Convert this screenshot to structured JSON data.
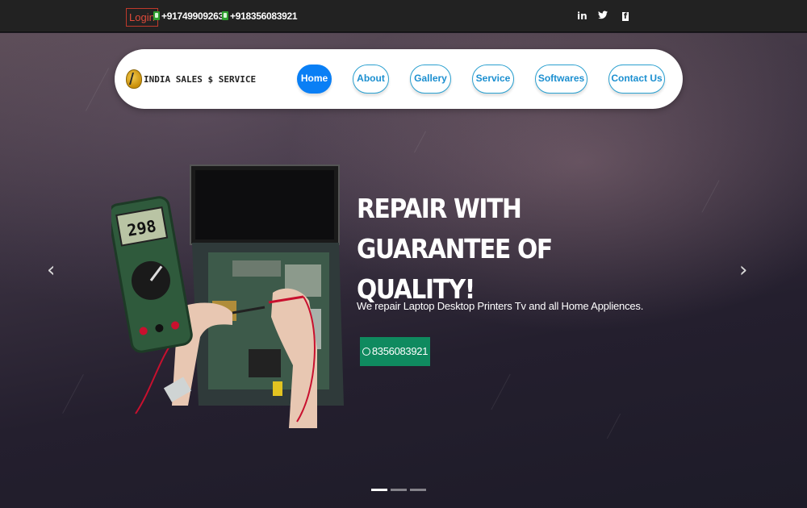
{
  "topbar": {
    "login_label": "Login",
    "phone1": "+917499092630",
    "phone2": "+918356083921",
    "social": [
      "linkedin-icon",
      "twitter-icon",
      "facebook-icon"
    ],
    "social_glyphs": [
      "in",
      "🐦",
      "f"
    ]
  },
  "brand": {
    "name": "INDIA SALES $ SERVICE",
    "logo_icon": "shield-logo-icon"
  },
  "nav": {
    "items": [
      {
        "label": "Home",
        "active": true
      },
      {
        "label": "About",
        "active": false
      },
      {
        "label": "Gallery",
        "active": false
      },
      {
        "label": "Service",
        "active": false
      },
      {
        "label": "Softwares",
        "active": false
      },
      {
        "label": "Contact Us",
        "active": false
      }
    ]
  },
  "hero": {
    "headline": "REPAIR WITH GUARANTEE OF QUALITY!",
    "subline": "We repair Laptop Desktop Printers Tv and all Home Appliences.",
    "whatsapp_number": "8356083921",
    "whatsapp_icon": "whatsapp-icon",
    "multimeter_reading": "298",
    "prev_arrow": "‹",
    "next_arrow": "›",
    "slides_total": 3,
    "active_slide": 1
  },
  "colors": {
    "topbar_bg": "#222222",
    "nav_active": "#0a7ff5",
    "nav_border": "#2aa0d0",
    "whatsapp_btn": "#0f8a5f",
    "login_red": "#e04a3a"
  }
}
